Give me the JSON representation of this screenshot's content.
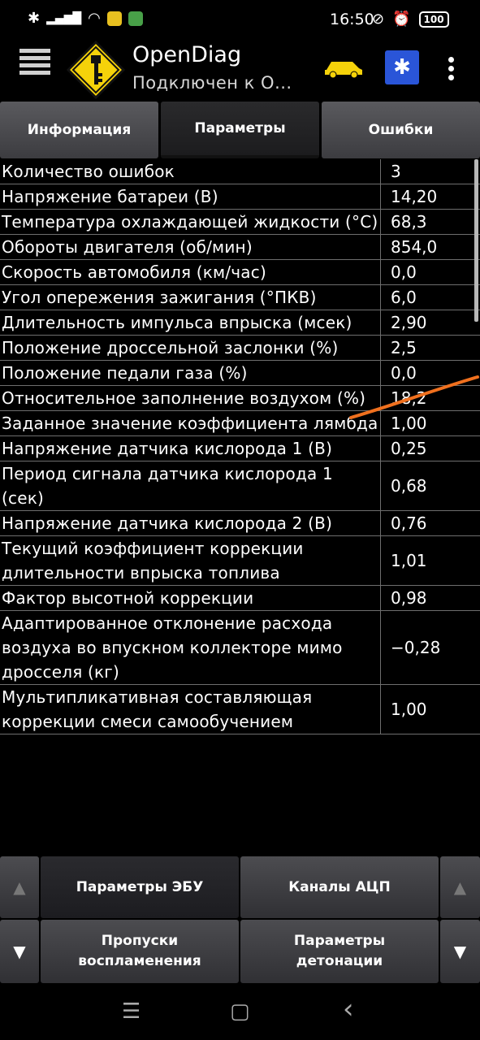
{
  "status": {
    "time": "16:50",
    "battery": "100"
  },
  "app": {
    "title": "OpenDiag",
    "subtitle": "Подключен к О..."
  },
  "tabs": [
    {
      "label": "Информация",
      "active": false
    },
    {
      "label": "Параметры",
      "active": true
    },
    {
      "label": "Ошибки",
      "active": false
    }
  ],
  "params": [
    {
      "name": "Количество ошибок",
      "value": "3"
    },
    {
      "name": "Напряжение батареи (В)",
      "value": "14,20"
    },
    {
      "name": "Температура охлаждающей жидкости (°С)",
      "value": "68,3"
    },
    {
      "name": "Обороты двигателя (об/мин)",
      "value": "854,0"
    },
    {
      "name": "Скорость автомобиля (км/час)",
      "value": "0,0"
    },
    {
      "name": "Угол опережения зажигания (°ПКВ)",
      "value": "6,0"
    },
    {
      "name": "Длительность импульса впрыска (мсек)",
      "value": "2,90"
    },
    {
      "name": "Положение дроссельной заслонки (%)",
      "value": "2,5"
    },
    {
      "name": "Положение педали газа (%)",
      "value": "0,0"
    },
    {
      "name": "Относительное заполнение воздухом (%)",
      "value": "18,2"
    },
    {
      "name": "Заданное значение коэффициента лямбда",
      "value": "1,00"
    },
    {
      "name": "Напряжение датчика кислорода 1 (В)",
      "value": "0,25"
    },
    {
      "name": "Период сигнала датчика кислорода 1 (сек)",
      "value": "0,68"
    },
    {
      "name": "Напряжение датчика кислорода 2 (В)",
      "value": "0,76"
    },
    {
      "name": "Текущий коэффициент коррекции длительности впрыска топлива",
      "value": "1,01"
    },
    {
      "name": "Фактор высотной коррекции",
      "value": "0,98"
    },
    {
      "name": "Адаптированное отклонение расхода воздуха во впускном коллекторе мимо дросселя (кг)",
      "value": "−0,28"
    },
    {
      "name": "Мультипликативная составляющая коррекции смеси самообучением",
      "value": "1,00"
    }
  ],
  "bottom": {
    "up_arrow": "▲",
    "down_arrow": "▼",
    "ecu_params": "Параметры ЭБУ",
    "adc_channels": "Каналы АЦП",
    "misfires": "Пропуски воспламенения",
    "knock_params": "Параметры детонации"
  },
  "nav": {
    "recents": "☰",
    "home": "▢",
    "back": "‹"
  },
  "colors": {
    "annotation_stroke": "#f0701e",
    "logo_yellow": "#f5d20a",
    "bluetooth_blue": "#2a55d8"
  }
}
